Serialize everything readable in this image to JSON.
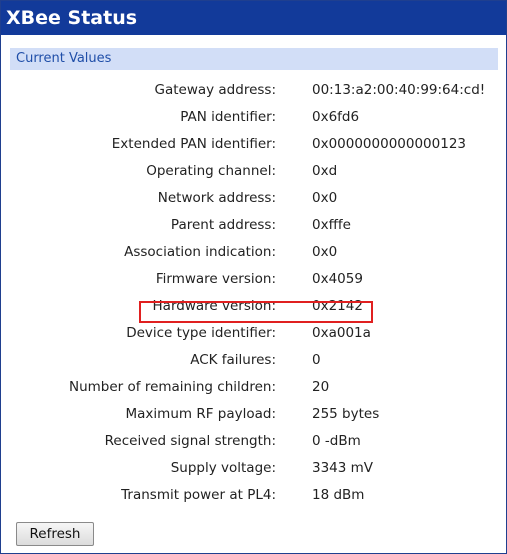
{
  "title": "XBee Status",
  "section": {
    "header": "Current Values"
  },
  "fields": [
    {
      "label": "Gateway address:",
      "value": "00:13:a2:00:40:99:64:cd!"
    },
    {
      "label": "PAN identifier:",
      "value": "0x6fd6"
    },
    {
      "label": "Extended PAN identifier:",
      "value": "0x0000000000000123"
    },
    {
      "label": "Operating channel:",
      "value": "0xd"
    },
    {
      "label": "Network address:",
      "value": "0x0"
    },
    {
      "label": "Parent address:",
      "value": "0xfffe"
    },
    {
      "label": "Association indication:",
      "value": "0x0"
    },
    {
      "label": "Firmware version:",
      "value": "0x4059"
    },
    {
      "label": "Hardware version:",
      "value": "0x2142"
    },
    {
      "label": "Device type identifier:",
      "value": "0xa001a"
    },
    {
      "label": "ACK failures:",
      "value": "0"
    },
    {
      "label": "Number of remaining children:",
      "value": "20"
    },
    {
      "label": "Maximum RF payload:",
      "value": "255 bytes"
    },
    {
      "label": "Received signal strength:",
      "value": "0 -dBm"
    },
    {
      "label": "Supply voltage:",
      "value": "3343 mV"
    },
    {
      "label": "Transmit power at PL4:",
      "value": "18 dBm"
    }
  ],
  "highlight": {
    "field": "Hardware version:",
    "color": "#e02020"
  },
  "buttons": {
    "refresh_label": "Refresh"
  },
  "colors": {
    "title_bar": "#123a9a",
    "section_header_bg": "#d2def7",
    "section_header_text": "#1f4ea8"
  }
}
